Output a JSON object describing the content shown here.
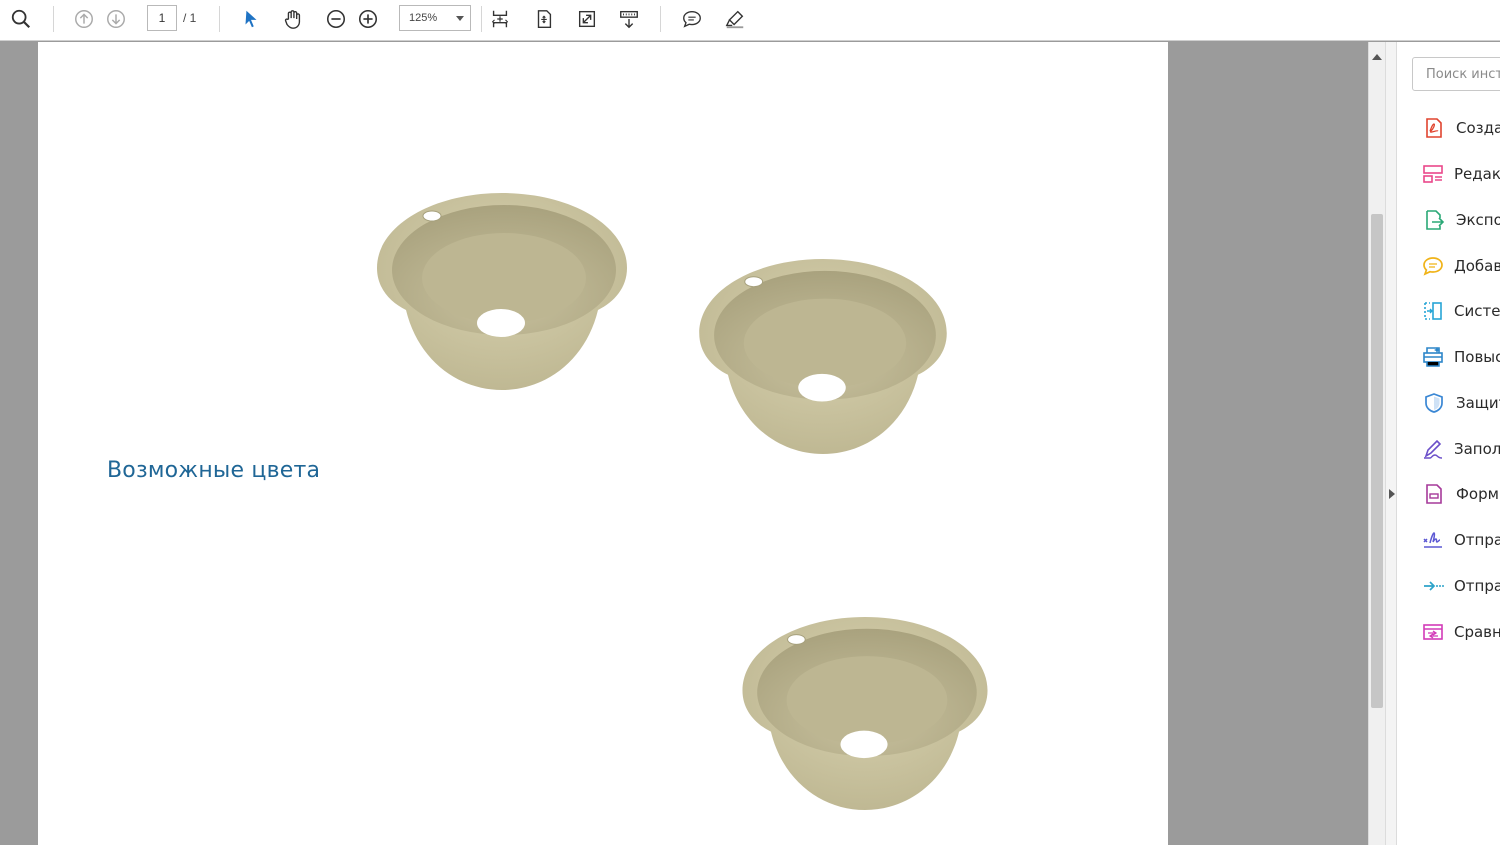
{
  "toolbar": {
    "page_current": "1",
    "page_total": "/  1",
    "zoom": "125%",
    "icons": [
      "search-icon",
      "prev-page-icon",
      "next-page-icon",
      "select-cursor-icon",
      "hand-tool-icon",
      "zoom-out-icon",
      "zoom-in-icon",
      "fit-page-icon",
      "fit-width-icon",
      "full-screen-icon",
      "scroll-mode-icon",
      "comment-icon",
      "highlight-pen-icon"
    ]
  },
  "document": {
    "heading": "Возможные цвета",
    "images": [
      "sink-image-1",
      "sink-image-2",
      "sink-image-3"
    ]
  },
  "tools_panel": {
    "search_placeholder": "Поиск инструментов",
    "items": [
      {
        "label": "Создать PDF",
        "icon": "create-pdf-icon",
        "color": "#e0442f"
      },
      {
        "label": "Редактировать PDF",
        "icon": "edit-pdf-icon",
        "color": "#e9488a"
      },
      {
        "label": "Экспорт PDF",
        "icon": "export-pdf-icon",
        "color": "#2aa876"
      },
      {
        "label": "Добавить комментарий",
        "icon": "comment-tool-icon",
        "color": "#f0b318"
      },
      {
        "label": "Систематизировать страницы",
        "icon": "organize-pages-icon",
        "color": "#27a5d6"
      },
      {
        "label": "Повысить качество сканов",
        "icon": "enhance-scans-icon",
        "color": "#2d86c9"
      },
      {
        "label": "Защитить",
        "icon": "protect-icon",
        "color": "#3a87d4"
      },
      {
        "label": "Заполнить и подписать",
        "icon": "fill-sign-icon",
        "color": "#6b4fc9"
      },
      {
        "label": "Формы",
        "icon": "forms-icon",
        "color": "#a63a9a"
      },
      {
        "label": "Отправить на подпись",
        "icon": "send-signature-icon",
        "color": "#5c58d3"
      },
      {
        "label": "Отправить и отслеживать",
        "icon": "send-track-icon",
        "color": "#2ca3c9"
      },
      {
        "label": "Сравнить файлы",
        "icon": "compare-icon",
        "color": "#d23bb8"
      }
    ]
  }
}
